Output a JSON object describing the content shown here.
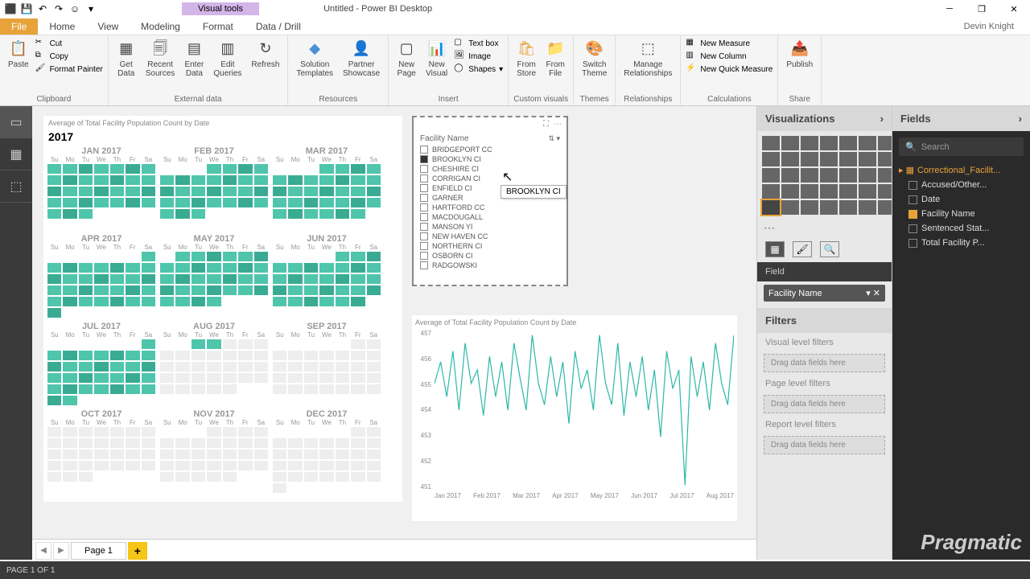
{
  "app": {
    "visual_tools": "Visual tools",
    "title": "Untitled - Power BI Desktop",
    "user": "Devin Knight"
  },
  "tabs": [
    "Home",
    "View",
    "Modeling",
    "Format",
    "Data / Drill"
  ],
  "file_tab": "File",
  "ribbon": {
    "clipboard": {
      "label": "Clipboard",
      "paste": "Paste",
      "cut": "Cut",
      "copy": "Copy",
      "painter": "Format Painter"
    },
    "external": {
      "label": "External data",
      "get": "Get\nData",
      "recent": "Recent\nSources",
      "enter": "Enter\nData",
      "edit": "Edit\nQueries",
      "refresh": "Refresh"
    },
    "resources": {
      "label": "Resources",
      "templates": "Solution\nTemplates",
      "showcase": "Partner\nShowcase"
    },
    "insert": {
      "label": "Insert",
      "page": "New\nPage",
      "visual": "New\nVisual",
      "textbox": "Text box",
      "image": "Image",
      "shapes": "Shapes"
    },
    "custom": {
      "label": "Custom visuals",
      "store": "From\nStore",
      "file": "From\nFile"
    },
    "themes": {
      "label": "Themes",
      "switch": "Switch\nTheme"
    },
    "relationships": {
      "label": "Relationships",
      "manage": "Manage\nRelationships"
    },
    "calc": {
      "label": "Calculations",
      "measure": "New Measure",
      "column": "New Column",
      "quick": "New Quick Measure"
    },
    "share": {
      "label": "Share",
      "publish": "Publish"
    }
  },
  "calendar": {
    "title": "Average of Total Facility Population Count by Date",
    "year": "2017",
    "months": [
      "JAN 2017",
      "FEB 2017",
      "MAR 2017",
      "APR 2017",
      "MAY 2017",
      "JUN 2017",
      "JUL 2017",
      "AUG 2017",
      "SEP 2017",
      "OCT 2017",
      "NOV 2017",
      "DEC 2017"
    ],
    "days": [
      "Su",
      "Mo",
      "Tu",
      "We",
      "Th",
      "Fr",
      "Sa"
    ]
  },
  "slicer": {
    "title": "Facility Name",
    "tooltip": "BROOKLYN CI",
    "items": [
      {
        "label": "BRIDGEPORT CC",
        "checked": false
      },
      {
        "label": "BROOKLYN CI",
        "checked": true
      },
      {
        "label": "CHESHIRE CI",
        "checked": false
      },
      {
        "label": "CORRIGAN CI",
        "checked": false
      },
      {
        "label": "ENFIELD CI",
        "checked": false
      },
      {
        "label": "GARNER",
        "checked": false
      },
      {
        "label": "HARTFORD CC",
        "checked": false
      },
      {
        "label": "MACDOUGALL",
        "checked": false
      },
      {
        "label": "MANSON YI",
        "checked": false
      },
      {
        "label": "NEW HAVEN CC",
        "checked": false
      },
      {
        "label": "NORTHERN CI",
        "checked": false
      },
      {
        "label": "OSBORN CI",
        "checked": false
      },
      {
        "label": "RADGOWSKI",
        "checked": false
      }
    ]
  },
  "chart_data": {
    "type": "line",
    "title": "Average of Total Facility Population Count by Date",
    "xlabel": "",
    "ylabel": "",
    "ylim": [
      451,
      457
    ],
    "yticks": [
      451,
      452,
      453,
      454,
      455,
      456,
      457
    ],
    "categories": [
      "Jan 2017",
      "Feb 2017",
      "Mar 2017",
      "Apr 2017",
      "May 2017",
      "Jun 2017",
      "Jul 2017",
      "Aug 2017"
    ],
    "values": [
      455.0,
      455.8,
      454.5,
      456.2,
      454.0,
      456.5,
      455.0,
      455.5,
      453.8,
      456.0,
      454.5,
      455.8,
      454.0,
      456.5,
      455.2,
      454.0,
      456.8,
      455.0,
      454.2,
      456.0,
      454.5,
      455.8,
      453.5,
      456.2,
      454.8,
      455.5,
      454.0,
      456.8,
      455.0,
      454.2,
      456.5,
      453.8,
      455.8,
      454.5,
      456.0,
      454.0,
      455.5,
      453.0,
      456.2,
      454.8,
      455.5,
      451.2,
      456.0,
      454.5,
      455.8,
      454.0,
      456.5,
      455.0,
      454.2,
      456.8
    ]
  },
  "vizpane": {
    "title": "Visualizations",
    "field_label": "Field",
    "field_value": "Facility Name",
    "filters": "Filters",
    "vlf": "Visual level filters",
    "drop": "Drag data fields here",
    "plf": "Page level filters",
    "rlf": "Report level filters"
  },
  "fieldspane": {
    "title": "Fields",
    "search": "Search",
    "table": "Correctional_Facilit...",
    "fields": [
      {
        "label": "Accused/Other...",
        "on": false
      },
      {
        "label": "Date",
        "on": false
      },
      {
        "label": "Facility Name",
        "on": true
      },
      {
        "label": "Sentenced Stat...",
        "on": false
      },
      {
        "label": "Total Facility P...",
        "on": false
      }
    ]
  },
  "pages": {
    "page1": "Page 1",
    "status": "PAGE 1 OF 1"
  },
  "watermark": "Pragmatic"
}
